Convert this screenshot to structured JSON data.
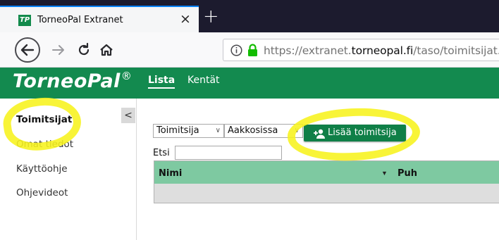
{
  "browser": {
    "tab_title": "TorneoPal Extranet",
    "favicon_text": "TP",
    "close_symbol": "×",
    "new_tab_symbol": "+",
    "url_prefix": "https://extranet.",
    "url_domain": "torneopal.fi",
    "url_path": "/taso/toimitsijat.ph"
  },
  "app": {
    "logo_text": "TorneoPal",
    "logo_reg": "®",
    "nav": [
      {
        "label": "Lista",
        "active": true
      },
      {
        "label": "Kentät",
        "active": false
      }
    ],
    "brand_color": "#138a4f"
  },
  "sidebar": {
    "collapse_symbol": "<",
    "items": [
      {
        "label": "Toimitsijat",
        "active": true
      },
      {
        "label": "Omat tiedot",
        "active": false
      },
      {
        "label": "Käyttöohje",
        "active": false
      },
      {
        "label": "Ohjevideot",
        "active": false
      }
    ]
  },
  "main": {
    "select_type": "Toimitsija",
    "select_order": "Aakkosissa",
    "add_button_label": "Lisää toimitsija",
    "search_label": "Etsi",
    "search_value": "",
    "columns": [
      "Nimi",
      "Puh"
    ]
  },
  "annotation_color": "#f7f21d"
}
